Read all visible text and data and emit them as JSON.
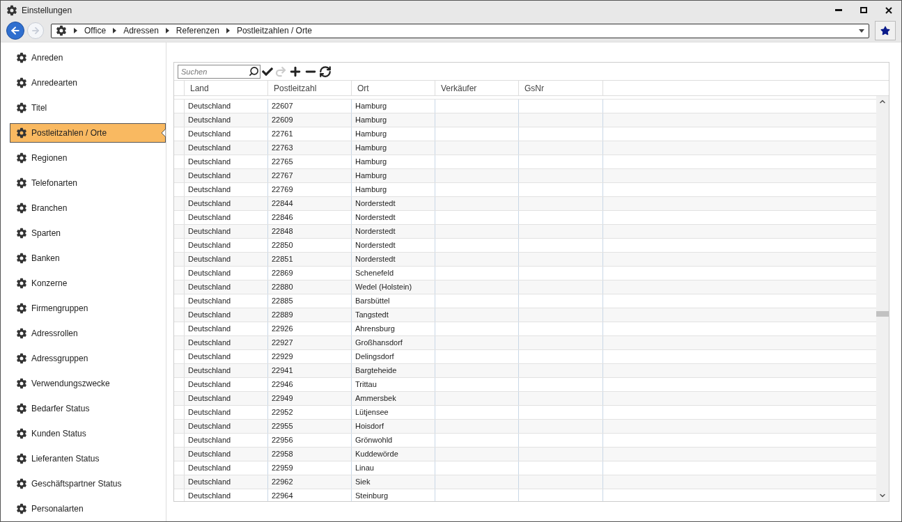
{
  "window": {
    "title": "Einstellungen"
  },
  "breadcrumb": [
    "Office",
    "Adressen",
    "Referenzen",
    "Postleitzahlen / Orte"
  ],
  "sidebar": {
    "items": [
      {
        "label": "Anreden",
        "selected": false
      },
      {
        "label": "Anredearten",
        "selected": false
      },
      {
        "label": "Titel",
        "selected": false
      },
      {
        "label": "Postleitzahlen / Orte",
        "selected": true
      },
      {
        "label": "Regionen",
        "selected": false
      },
      {
        "label": "Telefonarten",
        "selected": false
      },
      {
        "label": "Branchen",
        "selected": false
      },
      {
        "label": "Sparten",
        "selected": false
      },
      {
        "label": "Banken",
        "selected": false
      },
      {
        "label": "Konzerne",
        "selected": false
      },
      {
        "label": "Firmengruppen",
        "selected": false
      },
      {
        "label": "Adressrollen",
        "selected": false
      },
      {
        "label": "Adressgruppen",
        "selected": false
      },
      {
        "label": "Verwendungszwecke",
        "selected": false
      },
      {
        "label": "Bedarfer Status",
        "selected": false
      },
      {
        "label": "Kunden Status",
        "selected": false
      },
      {
        "label": "Lieferanten Status",
        "selected": false
      },
      {
        "label": "Geschäftspartner Status",
        "selected": false
      },
      {
        "label": "Personalarten",
        "selected": false
      }
    ]
  },
  "search": {
    "placeholder": "Suchen"
  },
  "table": {
    "columns": [
      "Land",
      "Postleitzahl",
      "Ort",
      "Verkäufer",
      "GsNr"
    ],
    "rows": [
      [
        "Deutschland",
        "22607",
        "Hamburg"
      ],
      [
        "Deutschland",
        "22609",
        "Hamburg"
      ],
      [
        "Deutschland",
        "22761",
        "Hamburg"
      ],
      [
        "Deutschland",
        "22763",
        "Hamburg"
      ],
      [
        "Deutschland",
        "22765",
        "Hamburg"
      ],
      [
        "Deutschland",
        "22767",
        "Hamburg"
      ],
      [
        "Deutschland",
        "22769",
        "Hamburg"
      ],
      [
        "Deutschland",
        "22844",
        "Norderstedt"
      ],
      [
        "Deutschland",
        "22846",
        "Norderstedt"
      ],
      [
        "Deutschland",
        "22848",
        "Norderstedt"
      ],
      [
        "Deutschland",
        "22850",
        "Norderstedt"
      ],
      [
        "Deutschland",
        "22851",
        "Norderstedt"
      ],
      [
        "Deutschland",
        "22869",
        "Schenefeld"
      ],
      [
        "Deutschland",
        "22880",
        "Wedel (Holstein)"
      ],
      [
        "Deutschland",
        "22885",
        "Barsbüttel"
      ],
      [
        "Deutschland",
        "22889",
        "Tangstedt"
      ],
      [
        "Deutschland",
        "22926",
        "Ahrensburg"
      ],
      [
        "Deutschland",
        "22927",
        "Großhansdorf"
      ],
      [
        "Deutschland",
        "22929",
        "Delingsdorf"
      ],
      [
        "Deutschland",
        "22941",
        "Bargteheide"
      ],
      [
        "Deutschland",
        "22946",
        "Trittau"
      ],
      [
        "Deutschland",
        "22949",
        "Ammersbek"
      ],
      [
        "Deutschland",
        "22952",
        "Lütjensee"
      ],
      [
        "Deutschland",
        "22955",
        "Hoisdorf"
      ],
      [
        "Deutschland",
        "22956",
        "Grönwohld"
      ],
      [
        "Deutschland",
        "22958",
        "Kuddewörde"
      ],
      [
        "Deutschland",
        "22959",
        "Linau"
      ],
      [
        "Deutschland",
        "22962",
        "Siek"
      ],
      [
        "Deutschland",
        "22964",
        "Steinburg"
      ]
    ]
  }
}
